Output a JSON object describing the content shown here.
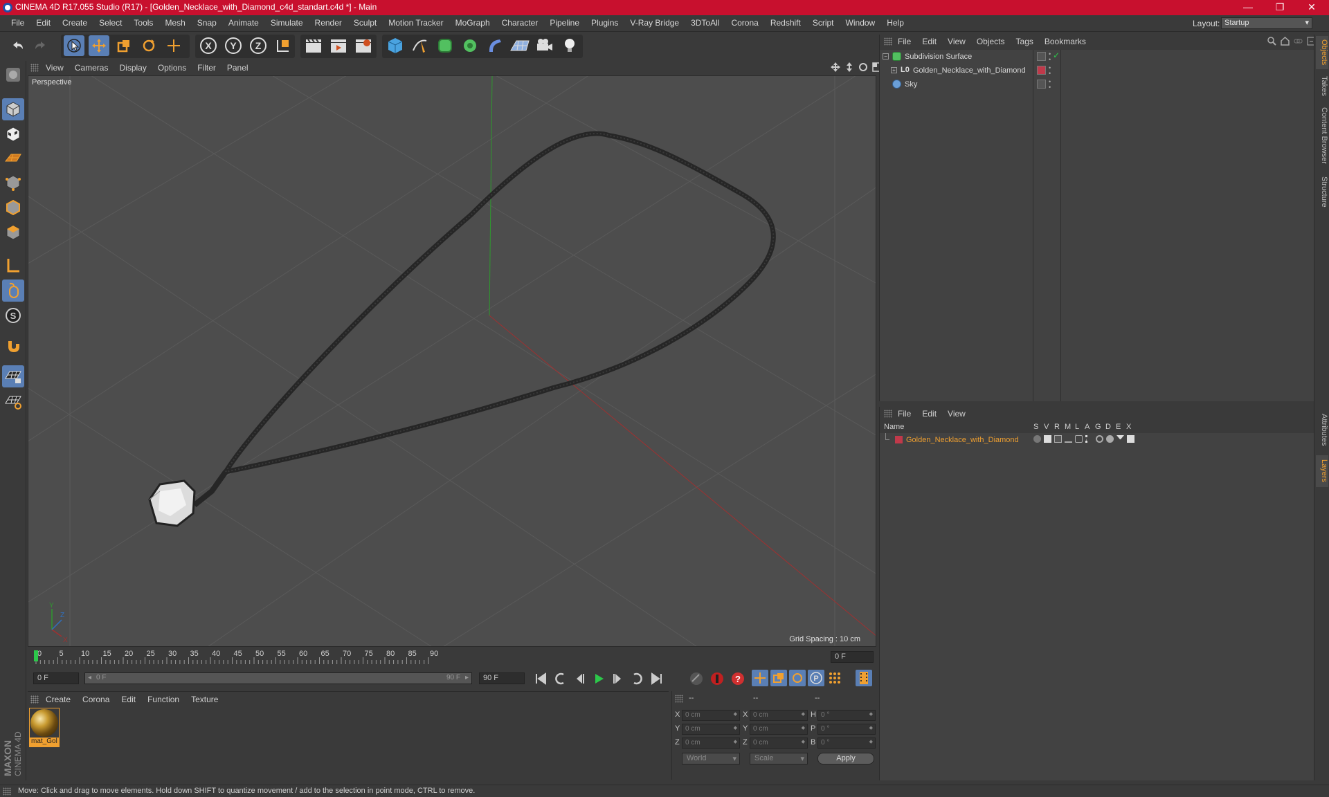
{
  "window": {
    "title": "CINEMA 4D R17.055 Studio (R17) - [Golden_Necklace_with_Diamond_c4d_standart.c4d *] - Main",
    "minimize": "—",
    "maximize": "❐",
    "close": "✕"
  },
  "menu": {
    "items": [
      "File",
      "Edit",
      "Create",
      "Select",
      "Tools",
      "Mesh",
      "Snap",
      "Animate",
      "Simulate",
      "Render",
      "Sculpt",
      "Motion Tracker",
      "MoGraph",
      "Character",
      "Pipeline",
      "Plugins",
      "V-Ray Bridge",
      "3DToAll",
      "Corona",
      "Redshift",
      "Script",
      "Window",
      "Help"
    ],
    "layout_label": "Layout:",
    "layout_value": "Startup"
  },
  "viewport": {
    "menu": [
      "View",
      "Cameras",
      "Display",
      "Options",
      "Filter",
      "Panel"
    ],
    "label": "Perspective",
    "grid_spacing": "Grid Spacing : 10 cm"
  },
  "timeline": {
    "ticks": [
      "0",
      "5",
      "10",
      "15",
      "20",
      "25",
      "30",
      "35",
      "40",
      "45",
      "50",
      "55",
      "60",
      "65",
      "70",
      "75",
      "80",
      "85",
      "90"
    ],
    "current_frame": "0 F",
    "start_field": "0 F",
    "range_start": "0 F",
    "range_end": "90 F",
    "end_field": "90 F"
  },
  "materials": {
    "menu": [
      "Create",
      "Corona",
      "Edit",
      "Function",
      "Texture"
    ],
    "items": [
      {
        "label": "mat_Gol"
      }
    ]
  },
  "coords": {
    "header": [
      "--",
      "--",
      "--"
    ],
    "rows": [
      {
        "a": "X",
        "av": "0 cm",
        "b": "X",
        "bv": "0 cm",
        "c": "H",
        "cv": "0 °"
      },
      {
        "a": "Y",
        "av": "0 cm",
        "b": "Y",
        "bv": "0 cm",
        "c": "P",
        "cv": "0 °"
      },
      {
        "a": "Z",
        "av": "0 cm",
        "b": "Z",
        "bv": "0 cm",
        "c": "B",
        "cv": "0 °"
      }
    ],
    "mode_world": "World",
    "mode_scale": "Scale",
    "apply": "Apply"
  },
  "objects": {
    "menu": [
      "File",
      "Edit",
      "View",
      "Objects",
      "Tags",
      "Bookmarks"
    ],
    "items": [
      {
        "name": "Subdivision Surface"
      },
      {
        "name": "Golden_Necklace_with_Diamond"
      },
      {
        "name": "Sky"
      }
    ]
  },
  "layers": {
    "menu": [
      "File",
      "Edit",
      "View"
    ],
    "header_name": "Name",
    "columns": [
      "S",
      "V",
      "R",
      "M",
      "L",
      "A",
      "G",
      "D",
      "E",
      "X"
    ],
    "items": [
      {
        "name": "Golden_Necklace_with_Diamond",
        "color": "#c0394a"
      }
    ]
  },
  "right_tabs": [
    "Objects",
    "Takes",
    "Content Browser",
    "Structure",
    "Attributes",
    "Layers"
  ],
  "status": "Move: Click and drag to move elements. Hold down SHIFT to quantize movement / add to the selection in point mode, CTRL to remove.",
  "colors": {
    "accent": "#f0a030",
    "selected": "#5a7fb5",
    "titlebar": "#c8102e"
  }
}
